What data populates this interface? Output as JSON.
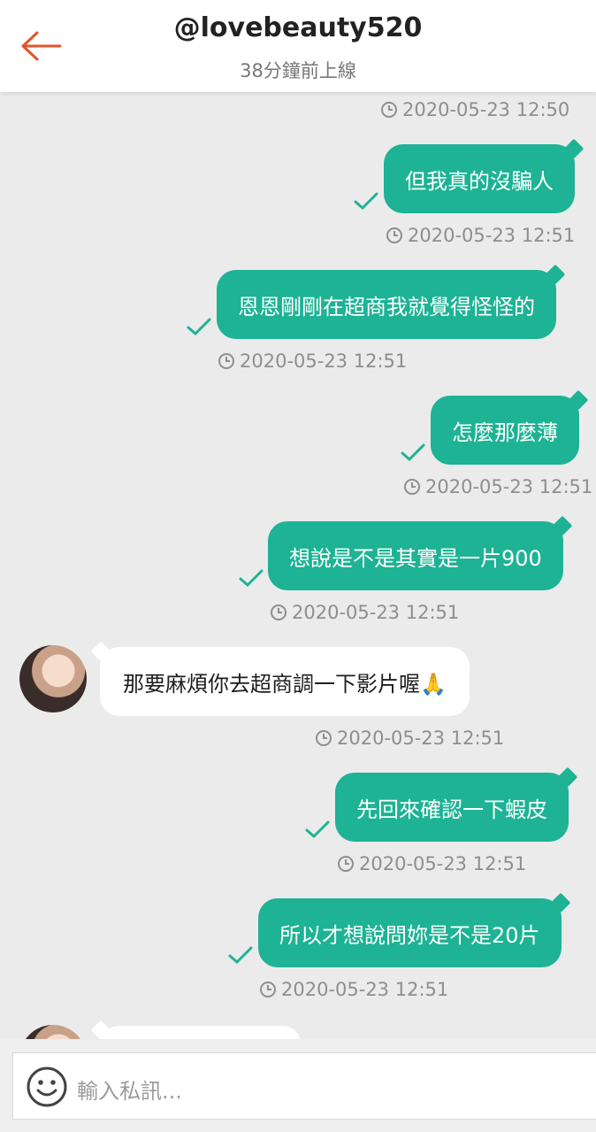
{
  "header": {
    "title": "@lovebeauty520",
    "status": "38分鐘前上線"
  },
  "messages": [
    {
      "text": "但我真的沒騙人",
      "time": "2020-05-23 12:51"
    },
    {
      "text": "恩恩剛剛在超商我就覺得怪怪的",
      "time": "2020-05-23 12:51"
    },
    {
      "text": "怎麼那麼薄",
      "time": "2020-05-23 12:51"
    },
    {
      "text": "想說是不是其實是一片900",
      "time": "2020-05-23 12:51"
    },
    {
      "text": "那要麻煩你去超商調一下影片喔🙏",
      "time": "2020-05-23 12:51"
    },
    {
      "text": "先回來確認一下蝦皮",
      "time": "2020-05-23 12:51"
    },
    {
      "text": "所以才想說問妳是不是20片",
      "time": "2020-05-23 12:51"
    }
  ],
  "top_timestamp": "2020-05-23 12:50",
  "input": {
    "placeholder": "輸入私訊..."
  },
  "colors": {
    "accent": "#e2532b",
    "bubble_out": "#1db394",
    "bubble_in": "#ffffff"
  }
}
